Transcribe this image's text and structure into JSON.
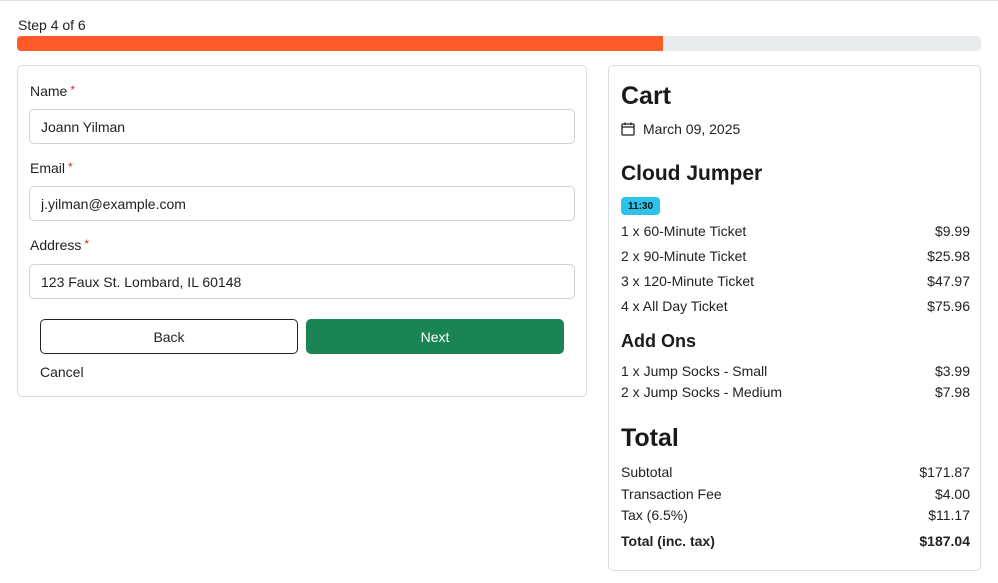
{
  "progress": {
    "label": "Step 4 of 6",
    "current_step": 4,
    "total_steps": 6,
    "fill_fraction": 0.67,
    "fill_color": "#ff5a2a",
    "track_color": "#e9ebee"
  },
  "form": {
    "fields": [
      {
        "label": "Name",
        "required_marker": "*",
        "value": "Joann Yilman"
      },
      {
        "label": "Email",
        "required_marker": "*",
        "value": "j.yilman@example.com"
      },
      {
        "label": "Address",
        "required_marker": "*",
        "value": "123 Faux St. Lombard, IL 60148"
      }
    ],
    "back_label": "Back",
    "next_label": "Next",
    "cancel_label": "Cancel",
    "next_color": "#1b8455"
  },
  "cart": {
    "title": "Cart",
    "date_icon": "calendar-icon",
    "date": "March 09, 2025",
    "product": "Cloud Jumper",
    "time_badge": "11:30",
    "badge_color": "#2bc4e8",
    "tickets": [
      {
        "label": "1 x 60-Minute Ticket",
        "price": "$9.99"
      },
      {
        "label": "2 x 90-Minute Ticket",
        "price": "$25.98"
      },
      {
        "label": "3 x 120-Minute Ticket",
        "price": "$47.97"
      },
      {
        "label": "4 x All Day Ticket",
        "price": "$75.96"
      }
    ],
    "addons_title": "Add Ons",
    "addons": [
      {
        "label": "1 x Jump Socks - Small",
        "price": "$3.99"
      },
      {
        "label": "2 x Jump Socks - Medium",
        "price": "$7.98"
      }
    ],
    "total_title": "Total",
    "summary": [
      {
        "label": "Subtotal",
        "price": "$171.87"
      },
      {
        "label": "Transaction Fee",
        "price": "$4.00"
      },
      {
        "label": "Tax (6.5%)",
        "price": "$11.17"
      }
    ],
    "grand_total": {
      "label": "Total (inc. tax)",
      "price": "$187.04"
    }
  }
}
